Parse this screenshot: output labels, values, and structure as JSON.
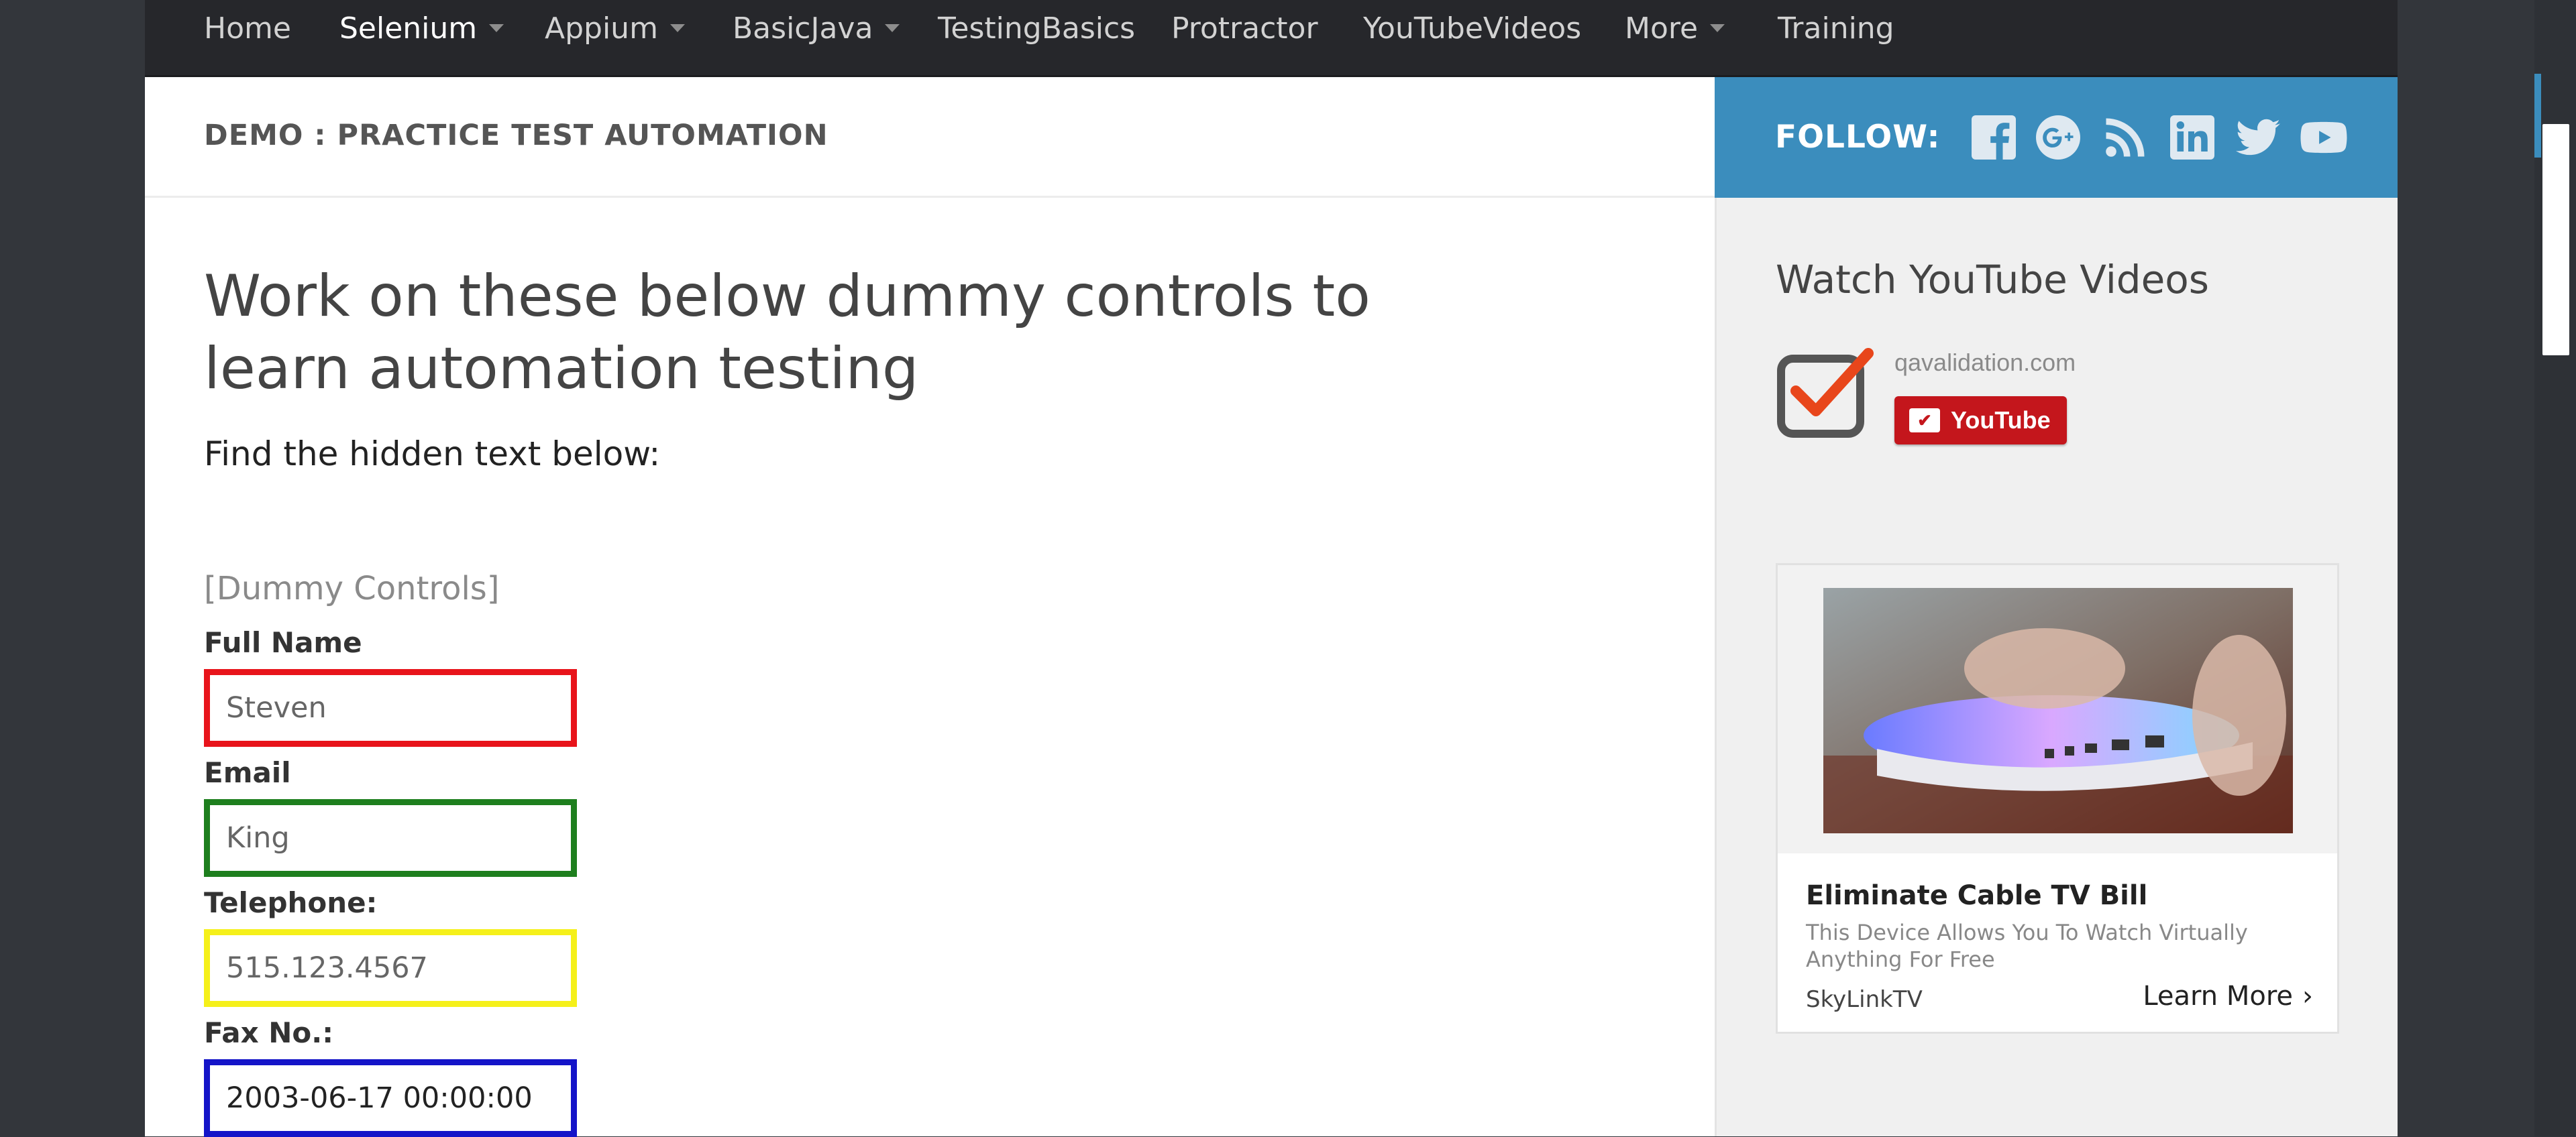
{
  "nav": {
    "items": [
      {
        "label": "Home"
      },
      {
        "label": "Selenium"
      },
      {
        "label": "Appium"
      },
      {
        "label": "BasicJava"
      },
      {
        "label": "TestingBasics"
      },
      {
        "label": "Protractor"
      },
      {
        "label": "YouTubeVideos"
      },
      {
        "label": "More"
      },
      {
        "label": "Training"
      }
    ]
  },
  "header": {
    "breadcrumb": "DEMO : PRACTICE TEST AUTOMATION",
    "follow_label": "FOLLOW:",
    "social_icons": [
      "facebook-icon",
      "google-plus-icon",
      "rss-icon",
      "linkedin-icon",
      "twitter-icon",
      "youtube-icon"
    ]
  },
  "main": {
    "heading": "Work on these below dummy controls to learn automation testing",
    "hidden_text_prompt": "Find the hidden text below:",
    "section_title": "[Dummy Controls]",
    "fields": [
      {
        "label": "Full Name",
        "value": "Steven",
        "border_color": "#e8141b"
      },
      {
        "label": "Email",
        "value": "King",
        "border_color": "#1e7f1e"
      },
      {
        "label": "Telephone:",
        "value": "515.123.4567",
        "border_color": "#f5f01a"
      },
      {
        "label": "Fax No.:",
        "value": "2003-06-17 00:00:00",
        "border_color": "#1414c8"
      }
    ]
  },
  "sidebar": {
    "youtube_title": "Watch YouTube Videos",
    "site_name": "qavalidation.com",
    "youtube_button": "YouTube",
    "ad": {
      "title": "Eliminate Cable TV Bill",
      "description": "This Device Allows You To Watch Virtually Anything For Free",
      "brand": "SkyLinkTV",
      "cta": "Learn More"
    }
  },
  "colors": {
    "nav_bg": "#26272b",
    "follow_bg": "#3b8dbd",
    "sidebar_bg": "#f0f0f0",
    "youtube_red": "#c4161c"
  }
}
